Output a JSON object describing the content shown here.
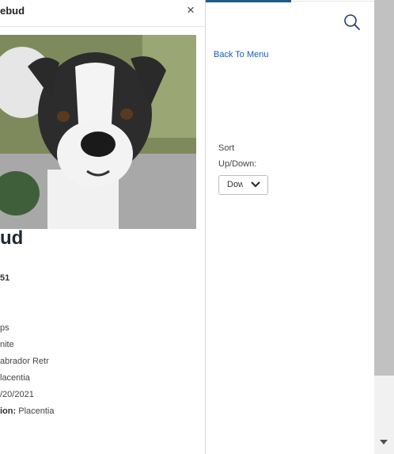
{
  "modal": {
    "title": "ebud",
    "close_label": "×"
  },
  "photo": {
    "icon": "dog-photo"
  },
  "pet": {
    "name": "ud",
    "id": "51",
    "details": [
      {
        "label": "",
        "value": "ps"
      },
      {
        "label": "",
        "value": "nite"
      },
      {
        "label": "",
        "value": "abrador Retr"
      },
      {
        "label": "",
        "value": "lacentia"
      },
      {
        "label": "",
        "value": "/20/2021"
      },
      {
        "label": "ion:",
        "value": " Placentia"
      }
    ]
  },
  "sidebar": {
    "search_icon": "search-icon",
    "back_label": "Back To Menu",
    "sort_label": "Sort Up/Down:",
    "sort_value": "Down",
    "accent_color": "#1f5a8c",
    "link_color": "#1a5ab8"
  }
}
